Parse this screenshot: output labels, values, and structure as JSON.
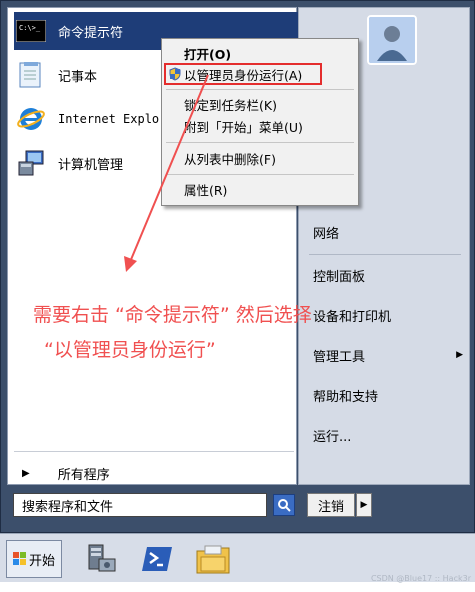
{
  "programs": [
    {
      "label": "命令提示符",
      "icon": "cmd-icon"
    },
    {
      "label": "记事本",
      "icon": "notepad-icon"
    },
    {
      "label": "Internet Explo",
      "icon": "ie-icon"
    },
    {
      "label": "计算机管理",
      "icon": "computer-management-icon"
    }
  ],
  "all_programs": "所有程序",
  "search": {
    "placeholder": "搜索程序和文件",
    "value": "搜索程序和文件"
  },
  "logout_label": "注销",
  "right_panel": [
    {
      "label": "网络"
    },
    {
      "label": "控制面板"
    },
    {
      "label": "设备和打印机"
    },
    {
      "label": "管理工具"
    },
    {
      "label": "帮助和支持"
    },
    {
      "label": "运行..."
    }
  ],
  "context_menu": {
    "open": "打开(O)",
    "run_as_admin": "以管理员身份运行(A)",
    "pin_taskbar": "锁定到任务栏(K)",
    "pin_start": "附到「开始」菜单(U)",
    "remove": "从列表中删除(F)",
    "properties": "属性(R)"
  },
  "annotation": {
    "line1": "需要右击 “命令提示符” 然后选择",
    "line2": "“以管理员身份运行”"
  },
  "taskbar": {
    "start_label": "开始"
  },
  "watermark": "CSDN @Blue17 :: Hack3r",
  "colors": {
    "accent": "#1e3d78",
    "annotation": "#f05050",
    "highlight_border": "#e42d2d"
  }
}
